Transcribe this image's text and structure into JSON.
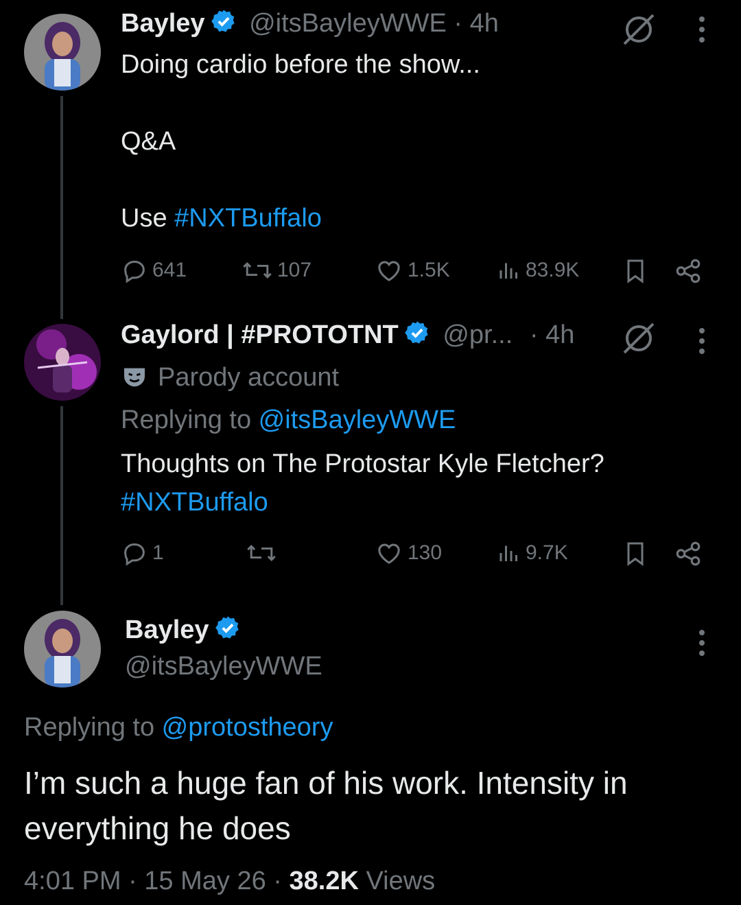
{
  "tweet1": {
    "name": "Bayley",
    "handle": "@itsBayleyWWE",
    "time": "· 4h",
    "lines": [
      "Doing cardio before the show...",
      "Q&A",
      "Use "
    ],
    "hashtag": "#NXTBuffalo",
    "replies": "641",
    "reposts": "107",
    "likes": "1.5K",
    "views": "83.9K"
  },
  "tweet2": {
    "name": "Gaylord | #PROTOTNT",
    "handle": "@pr...",
    "time": "· 4h",
    "parody_label": "Parody account",
    "replying_prefix": "Replying to ",
    "replying_handle": "@itsBayleyWWE",
    "text": "Thoughts on The Protostar Kyle Fletcher?",
    "hashtag": "#NXTBuffalo",
    "replies": "1",
    "reposts": "",
    "likes": "130",
    "views": "9.7K"
  },
  "main": {
    "name": "Bayley",
    "handle": "@itsBayleyWWE",
    "replying_prefix": "Replying to ",
    "replying_handle": "@protostheory",
    "line1": "I’m such a huge fan of his work. Intensity in",
    "line2": "everything he does",
    "time": "4:01 PM · 15 May 26 · ",
    "views_count": "38.2K",
    "views_label": " Views"
  },
  "colors": {
    "background": "#000000",
    "link": "#1d9bf0",
    "muted": "#71767b",
    "text": "#e7e9ea",
    "verified": "#1d9bf0"
  },
  "icons": [
    "grok-icon",
    "more-icon",
    "reply-icon",
    "repost-icon",
    "like-icon",
    "views-icon",
    "bookmark-icon",
    "share-icon",
    "verified-badge-icon",
    "parody-mask-icon"
  ]
}
